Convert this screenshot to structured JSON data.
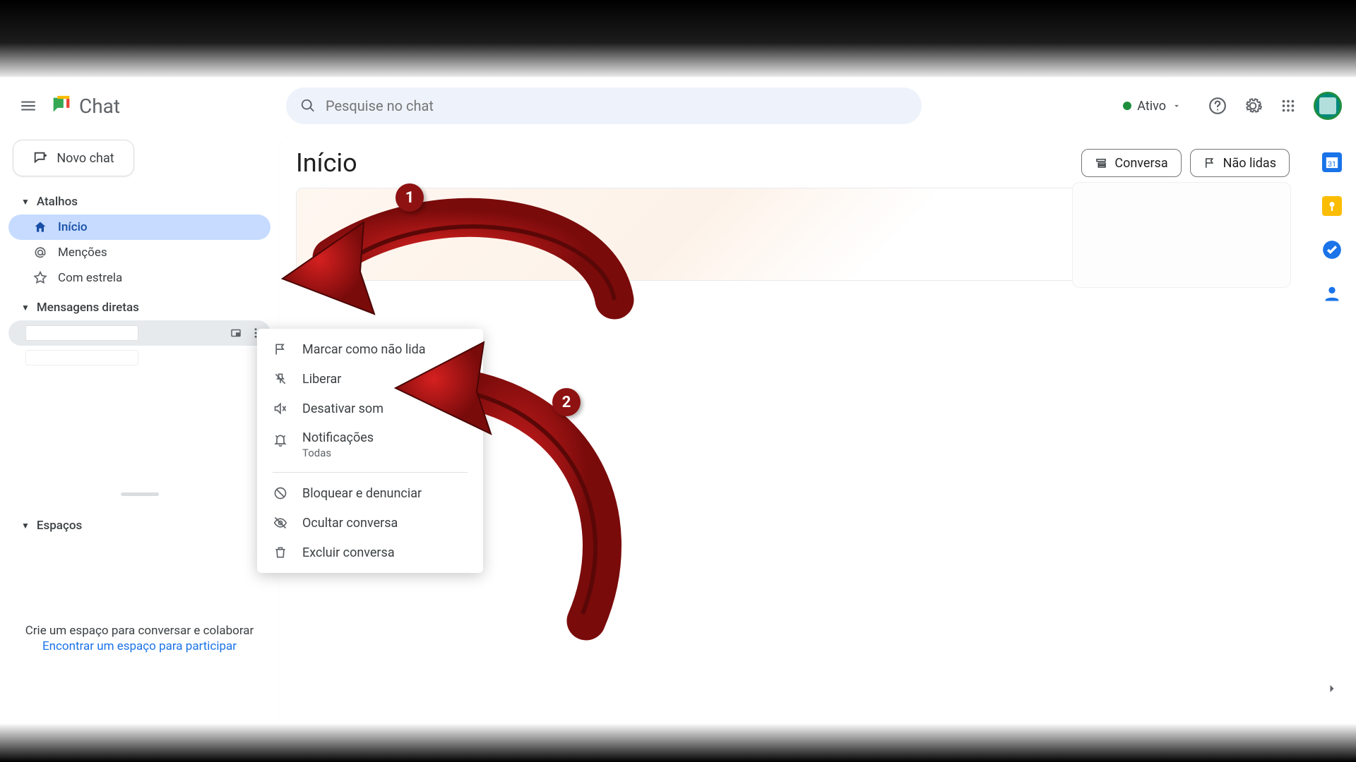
{
  "app": {
    "name": "Chat"
  },
  "header": {
    "search_placeholder": "Pesquise no chat",
    "status_label": "Ativo"
  },
  "sidebar": {
    "new_chat_label": "Novo chat",
    "sections": {
      "shortcuts": {
        "title": "Atalhos",
        "items": [
          {
            "label": "Início"
          },
          {
            "label": "Menções"
          },
          {
            "label": "Com estrela"
          }
        ]
      },
      "dms": {
        "title": "Mensagens diretas"
      },
      "spaces": {
        "title": "Espaços"
      }
    },
    "footer_text": "Crie um espaço para conversar e colaborar",
    "footer_link": "Encontrar um espaço para participar"
  },
  "main": {
    "title": "Início",
    "filter_chips": {
      "conversa": "Conversa",
      "nao_lidas": "Não lidas"
    }
  },
  "context_menu": {
    "items": {
      "mark_unread": "Marcar como não lida",
      "unpin": "Liberar",
      "mute": "Desativar som",
      "notifications": "Notificações",
      "notifications_sub": "Todas",
      "block": "Bloquear e denunciar",
      "hide": "Ocultar conversa",
      "delete": "Excluir conversa"
    }
  },
  "annotations": {
    "step1": "1",
    "step2": "2"
  },
  "colors": {
    "accent_blue": "#1a73e8",
    "active_bg": "#c6dbff",
    "annotation_red": "#b01116",
    "status_green": "#1e8e3e"
  }
}
